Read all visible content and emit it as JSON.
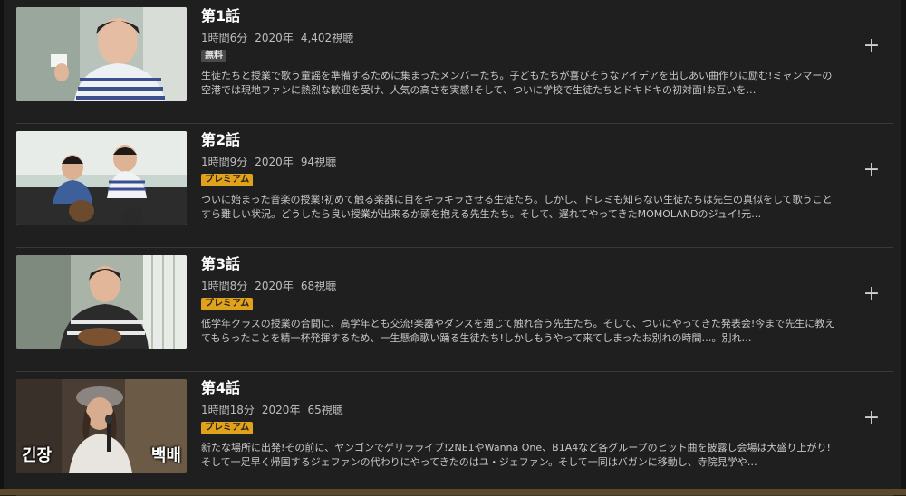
{
  "episodes": [
    {
      "title": "第1話",
      "duration": "1時間6分",
      "year": "2020年",
      "views": "4,402視聴",
      "badge": "無料",
      "badge_type": "free",
      "description": "生徒たちと授業で歌う童謡を準備するために集まったメンバーたち。子どもたちが喜びそうなアイデアを出しあい曲作りに励む!ミャンマーの空港では現地ファンに熱烈な歓迎を受け、人気の高さを実感!そして、ついに学校で生徒たちとドキドキの初対面!お互いを…",
      "add_icon": "plus-icon"
    },
    {
      "title": "第2話",
      "duration": "1時間9分",
      "year": "2020年",
      "views": "94視聴",
      "badge": "プレミアム",
      "badge_type": "premium",
      "description": "ついに始まった音楽の授業!初めて触る楽器に目をキラキラさせる生徒たち。しかし、ドレミも知らない生徒たちは先生の真似をして歌うことすら難しい状況。どうしたら良い授業が出来るか頭を抱える先生たち。そして、遅れてやってきたMOMOLANDのジュイ!元…",
      "add_icon": "plus-icon"
    },
    {
      "title": "第3話",
      "duration": "1時間8分",
      "year": "2020年",
      "views": "68視聴",
      "badge": "プレミアム",
      "badge_type": "premium",
      "description": "低学年クラスの授業の合間に、高学年とも交流!楽器やダンスを通じて触れ合う先生たち。そして、ついにやってきた発表会!今まで先生に教えてもらったことを精一杯発揮するため、一生懸命歌い踊る生徒たち!しかしもうやって来てしまったお別れの時間…。別れ…",
      "add_icon": "plus-icon"
    },
    {
      "title": "第4話",
      "duration": "1時間18分",
      "year": "2020年",
      "views": "65視聴",
      "badge": "プレミアム",
      "badge_type": "premium",
      "description": "新たな場所に出発!その前に、ヤンゴンでゲリラライブ!2NE1やWanna One、B1A4など各グループのヒット曲を披露し会場は大盛り上がり!そして一足早く帰国するジェファンの代わりにやってきたのはユ・ジェファン。そして一同はバガンに移動し、寺院見学や…",
      "add_icon": "plus-icon",
      "thumb_caption_left": "긴장",
      "thumb_caption_right": "백배"
    }
  ],
  "colors": {
    "background": "#1f1f1f",
    "premium_badge": "#e0a21b",
    "free_badge": "#4a4a4a"
  }
}
